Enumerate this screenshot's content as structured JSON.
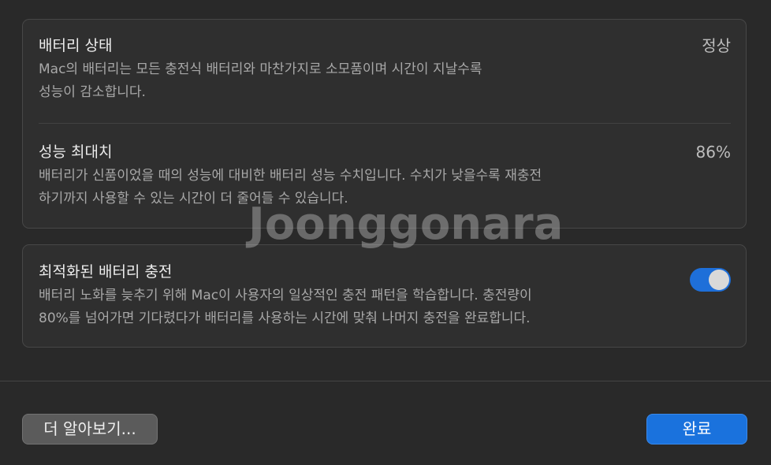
{
  "battery_health": {
    "title": "배터리 상태",
    "value": "정상",
    "description": "Mac의 배터리는 모든 충전식 배터리와 마찬가지로 소모품이며 시간이 지날수록\n성능이 감소합니다."
  },
  "max_capacity": {
    "title": "성능 최대치",
    "value": "86%",
    "description": "배터리가 신품이었을 때의 성능에 대비한 배터리 성능 수치입니다. 수치가 낮을수록 재충전\n하기까지 사용할 수 있는 시간이 더 줄어들 수 있습니다."
  },
  "optimized_charging": {
    "title": "최적화된 배터리 충전",
    "enabled": true,
    "description": "배터리 노화를 늦추기 위해 Mac이 사용자의 일상적인 충전 패턴을 학습합니다. 충전량이\n80%를 넘어가면 기다렸다가 배터리를 사용하는 시간에 맞춰 나머지 충전을 완료합니다."
  },
  "watermark": "Joonggonara",
  "buttons": {
    "learn_more": "더 알아보기...",
    "done": "완료"
  },
  "colors": {
    "accent": "#1a72dd",
    "background": "#292929"
  }
}
